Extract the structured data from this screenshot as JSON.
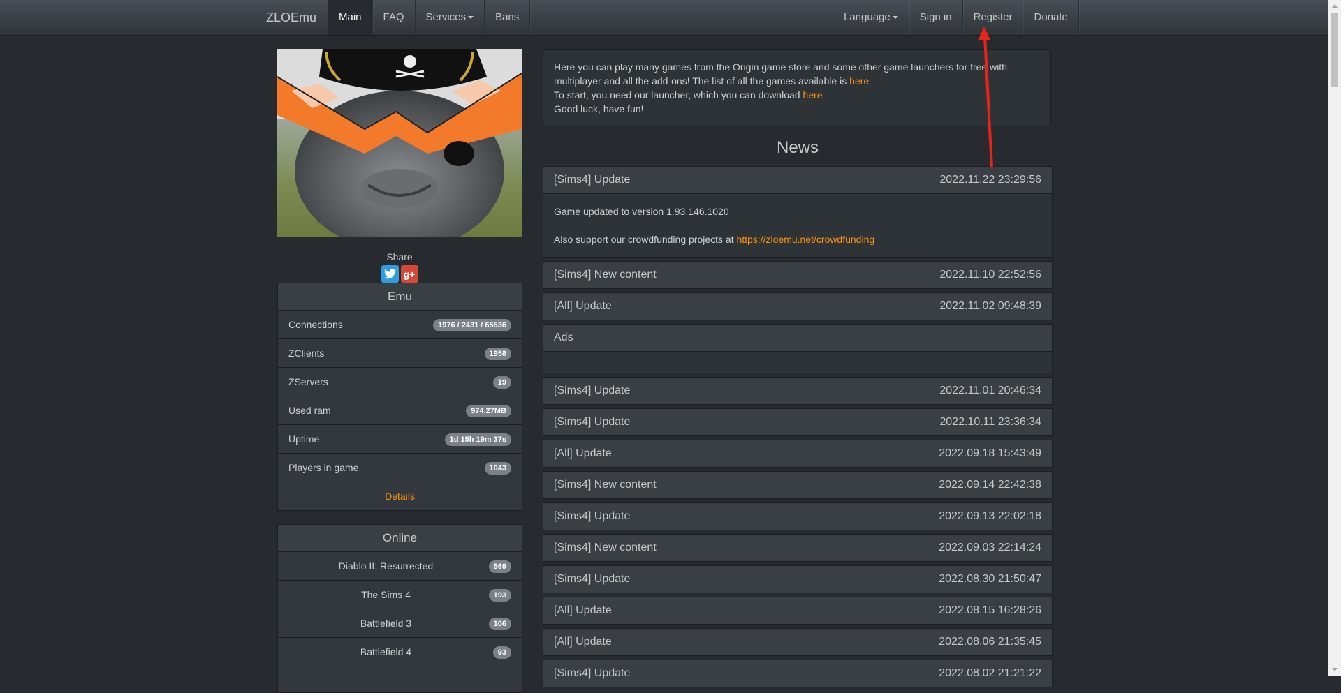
{
  "navbar": {
    "brand": "ZLOEmu",
    "left_items": [
      {
        "label": "Main",
        "active": true
      },
      {
        "label": "FAQ"
      },
      {
        "label": "Services",
        "dropdown": true
      },
      {
        "label": "Bans"
      }
    ],
    "right_items": [
      {
        "label": "Language",
        "dropdown": true
      },
      {
        "label": "Sign in"
      },
      {
        "label": "Register"
      },
      {
        "label": "Donate"
      }
    ]
  },
  "share": {
    "label": "Share",
    "icons": [
      "twitter-icon",
      "google-plus-icon"
    ],
    "gplus_glyph": "g+"
  },
  "emu_panel": {
    "title": "Emu",
    "rows": [
      {
        "label": "Connections",
        "value": "1976 / 2431 / 65536"
      },
      {
        "label": "ZClients",
        "value": "1958"
      },
      {
        "label": "ZServers",
        "value": "19"
      },
      {
        "label": "Used ram",
        "value": "974.27MB"
      },
      {
        "label": "Uptime",
        "value": "1d 15h 19m 37s"
      },
      {
        "label": "Players in game",
        "value": "1043"
      }
    ],
    "details_link": "Details"
  },
  "online_panel": {
    "title": "Online",
    "rows": [
      {
        "label": "Diablo II: Resurrected",
        "value": "569"
      },
      {
        "label": "The Sims 4",
        "value": "193"
      },
      {
        "label": "Battlefield 3",
        "value": "106"
      },
      {
        "label": "Battlefield 4",
        "value": "93"
      }
    ]
  },
  "welcome": {
    "line1_pre": "Here you can play many games from the Origin game store and some other game launchers for free with multiplayer and all the add-ons! The list of all the games available is ",
    "line1_link": "here",
    "line2_pre": "To start, you need our launcher, which you can download ",
    "line2_link": "here",
    "line3": "Good luck, have fun!"
  },
  "news": {
    "title": "News",
    "first": {
      "title": "[Sims4] Update",
      "date": "2022.11.22 23:29:56",
      "body1": "Game updated to version 1.93.146.1020",
      "body2_pre": "Also support our crowdfunding projects at ",
      "body2_link": "https://zloemu.net/crowdfunding"
    },
    "items_a": [
      {
        "title": "[Sims4] New content",
        "date": "2022.11.10 22:52:56"
      },
      {
        "title": "[All] Update",
        "date": "2022.11.02 09:48:39"
      }
    ],
    "ads_title": "Ads",
    "items_b": [
      {
        "title": "[Sims4] Update",
        "date": "2022.11.01 20:46:34"
      },
      {
        "title": "[Sims4] Update",
        "date": "2022.10.11 23:36:34"
      },
      {
        "title": "[All] Update",
        "date": "2022.09.18 15:43:49"
      },
      {
        "title": "[Sims4] New content",
        "date": "2022.09.14 22:42:38"
      },
      {
        "title": "[Sims4] Update",
        "date": "2022.09.13 22:02:18"
      },
      {
        "title": "[Sims4] New content",
        "date": "2022.09.03 22:14:24"
      },
      {
        "title": "[Sims4] Update",
        "date": "2022.08.30 21:50:47"
      },
      {
        "title": "[All] Update",
        "date": "2022.08.15 16:28:26"
      },
      {
        "title": "[All] Update",
        "date": "2022.08.06 21:35:45"
      },
      {
        "title": "[Sims4] Update",
        "date": "2022.08.02 21:21:22"
      }
    ]
  },
  "colors": {
    "background": "#272b30",
    "accent_link": "#f89406",
    "badge": "#7a8288",
    "annotation_arrow": "#e8231a"
  }
}
